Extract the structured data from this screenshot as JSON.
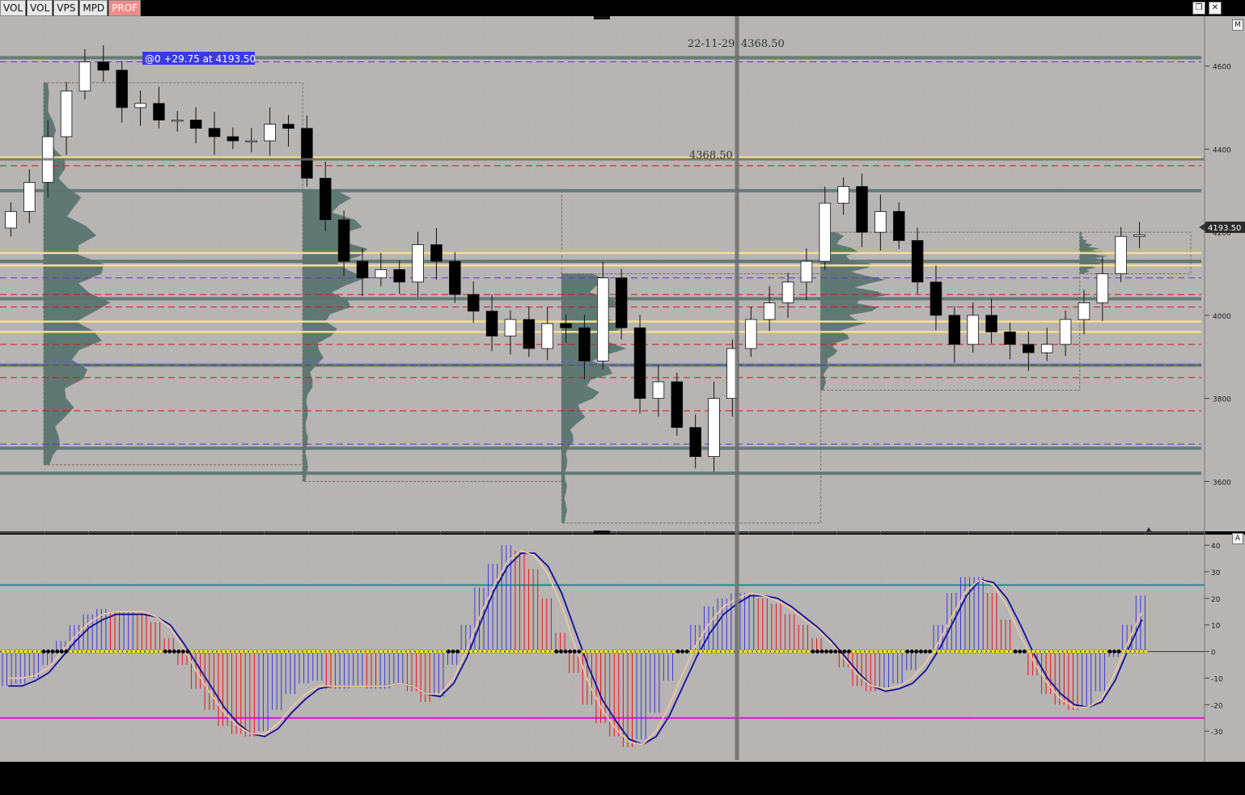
{
  "toolbar": [
    {
      "label": "VOL",
      "active": false
    },
    {
      "label": "VOL",
      "active": false
    },
    {
      "label": "VPS",
      "active": false
    },
    {
      "label": "MPD",
      "active": false
    },
    {
      "label": "PROF",
      "active": true
    }
  ],
  "window": {
    "restore_icon": "restore-icon",
    "close_icon": "close-icon",
    "close_glyph": "✕",
    "restore_glyph": "❐"
  },
  "labels": {
    "trade_info": "@0  +29.75 at 4193.50",
    "crosshair_date": "22-11-29",
    "crosshair_value": "4368.50",
    "crosshair_level": "4368.50",
    "last_price": "4193.50",
    "price_pane_tag": "M",
    "osc_pane_tag": "A"
  },
  "colors": {
    "background": "#b7b4b4",
    "bull_body": "#ffffff",
    "bear_body": "#000000",
    "profile_fill": "#5b7570",
    "profile_fill_light": "#7d7a80",
    "poc_line": "#f4e08c",
    "hvn_line": "#5b7570",
    "vah_val_line": "#dd1111",
    "prev_value_line": "#6a2fd0",
    "osc_bull": "#3a3ad6",
    "osc_bear": "#ee1111",
    "signal_line": "#f3c9a0",
    "smooth_line": "#11119a",
    "upper_level": "#1a9090",
    "lower_level": "#e010e0",
    "zero_dot_yellow": "#ffff00",
    "zero_dot_black": "#000000"
  },
  "chart_data": [
    {
      "type": "candlestick",
      "name": "price",
      "y_axis_ticks": [
        4600,
        4400,
        4200,
        4000,
        3800,
        3600
      ],
      "ylim": [
        3480,
        4720
      ],
      "bar_count": 62,
      "close": [
        4250,
        4320,
        4430,
        4540,
        4610,
        4590,
        4500,
        4510,
        4470,
        4470,
        4450,
        4430,
        4420,
        4420,
        4460,
        4450,
        4330,
        4230,
        4130,
        4090,
        4110,
        4080,
        4170,
        4130,
        4050,
        4010,
        3950,
        3990,
        3920,
        3980,
        3970,
        3890,
        4090,
        3970,
        3800,
        3840,
        3730,
        3660,
        3800,
        3920,
        3990,
        4030,
        4080,
        4130,
        4270,
        4310,
        4200,
        4250,
        4180,
        4080,
        4000,
        3930,
        4000,
        3960,
        3930,
        3910,
        3930,
        3990,
        4030,
        4100,
        4190,
        4193.5
      ],
      "hvn_levels": [
        4620,
        4300,
        4130,
        4040,
        3880,
        3680,
        3620
      ],
      "poc_levels": [
        4380,
        4150,
        3960,
        3985,
        4120
      ],
      "vah_val_levels": [
        4360,
        4050,
        3850,
        3770,
        4020,
        3930
      ],
      "prev_value_levels": [
        4610,
        4090,
        3690,
        3880
      ]
    },
    {
      "type": "bar",
      "name": "oscillator",
      "y_axis_ticks": [
        40,
        30,
        20,
        10,
        0,
        -10,
        -20,
        -30
      ],
      "ylim": [
        -40,
        44
      ],
      "upper_level": 25,
      "lower_level": -25,
      "values": [
        -13,
        -12,
        -10,
        -5,
        4,
        10,
        14,
        16,
        15,
        15,
        14,
        11,
        5,
        -5,
        -14,
        -22,
        -28,
        -31,
        -32,
        -30,
        -22,
        -16,
        -12,
        -11,
        -14,
        -14,
        -13,
        -14,
        -14,
        -12,
        -15,
        -19,
        -17,
        -5,
        10,
        24,
        33,
        40,
        38,
        31,
        20,
        7,
        -8,
        -20,
        -27,
        -32,
        -36,
        -33,
        -23,
        -11,
        0,
        10,
        17,
        20,
        22,
        22,
        20,
        18,
        14,
        10,
        5,
        0,
        -6,
        -13,
        -15,
        -14,
        -12,
        -7,
        0,
        10,
        22,
        28,
        28,
        22,
        12,
        0,
        -9,
        -16,
        -20,
        -22,
        -21,
        -15,
        -2,
        10,
        21
      ],
      "signal": [
        -10,
        -10,
        -9,
        -6,
        0,
        6,
        11,
        14,
        15,
        15,
        15,
        13,
        9,
        1,
        -8,
        -16,
        -23,
        -28,
        -31,
        -31,
        -27,
        -21,
        -16,
        -13,
        -13,
        -13,
        -13,
        -13,
        -13,
        -12,
        -13,
        -16,
        -16,
        -10,
        1,
        14,
        25,
        34,
        38,
        36,
        29,
        17,
        2,
        -12,
        -22,
        -29,
        -34,
        -35,
        -30,
        -20,
        -8,
        3,
        11,
        17,
        20,
        22,
        21,
        19,
        16,
        12,
        8,
        3,
        -3,
        -9,
        -13,
        -14,
        -13,
        -10,
        -4,
        4,
        14,
        23,
        27,
        25,
        17,
        6,
        -4,
        -12,
        -18,
        -21,
        -21,
        -18,
        -8,
        4,
        15
      ],
      "smooth": [
        -13,
        -13,
        -11,
        -8,
        -2,
        4,
        9,
        12,
        14,
        14,
        14,
        13,
        10,
        3,
        -5,
        -13,
        -21,
        -27,
        -31,
        -32,
        -29,
        -23,
        -18,
        -14,
        -13,
        -13,
        -13,
        -13,
        -13,
        -12,
        -13,
        -16,
        -17,
        -12,
        -2,
        11,
        23,
        32,
        37,
        37,
        32,
        22,
        8,
        -6,
        -18,
        -26,
        -33,
        -35,
        -32,
        -24,
        -13,
        -2,
        7,
        14,
        18,
        21,
        21,
        20,
        17,
        13,
        9,
        4,
        -2,
        -8,
        -13,
        -15,
        -14,
        -12,
        -7,
        1,
        11,
        21,
        27,
        26,
        20,
        10,
        -1,
        -10,
        -16,
        -20,
        -21,
        -19,
        -11,
        1,
        12
      ]
    }
  ]
}
